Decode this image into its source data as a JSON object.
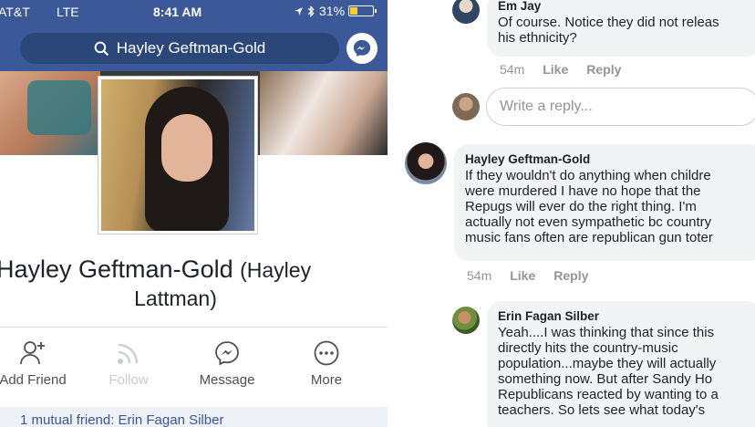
{
  "status_bar": {
    "carrier": "AT&T",
    "network": "LTE",
    "time": "8:41 AM",
    "battery": "31%",
    "battery_fraction": 0.31
  },
  "search": {
    "query": "Hayley Geftman-Gold"
  },
  "profile": {
    "name": "Hayley Geftman-Gold",
    "alt_name_part1": "(Hayley",
    "alt_name_part2": "Lattman)"
  },
  "actions": [
    {
      "label": "Add Friend",
      "icon": "add-friend-icon"
    },
    {
      "label": "Follow",
      "icon": "follow-icon"
    },
    {
      "label": "Message",
      "icon": "messenger-icon"
    },
    {
      "label": "More",
      "icon": "more-icon"
    }
  ],
  "mutual_friends": {
    "text": "1 mutual friend: Erin Fagan Silber"
  },
  "comments": [
    {
      "author": "Em Jay",
      "lines": [
        "Of course. Notice they did not releas",
        "his ethnicity?"
      ],
      "time": "54m",
      "like": "Like",
      "reply": "Reply"
    },
    {
      "author": "Hayley Geftman-Gold",
      "lines": [
        "If they wouldn't do anything when childre",
        "were murdered I have no hope that the",
        "Repugs will ever do the right thing.  I'm",
        "actually not even sympathetic bc country",
        "music fans often are republican gun toter"
      ],
      "time": "54m",
      "like": "Like",
      "reply": "Reply"
    },
    {
      "author": "Erin Fagan Silber",
      "lines": [
        "Yeah....I was thinking that since this",
        "directly hits the country-music",
        "population...maybe they will actually",
        "something now.  But after Sandy Ho",
        "Republicans reacted by wanting to a",
        "teachers.  So lets see what today's"
      ]
    }
  ],
  "reply_box": {
    "placeholder": "Write a reply..."
  }
}
